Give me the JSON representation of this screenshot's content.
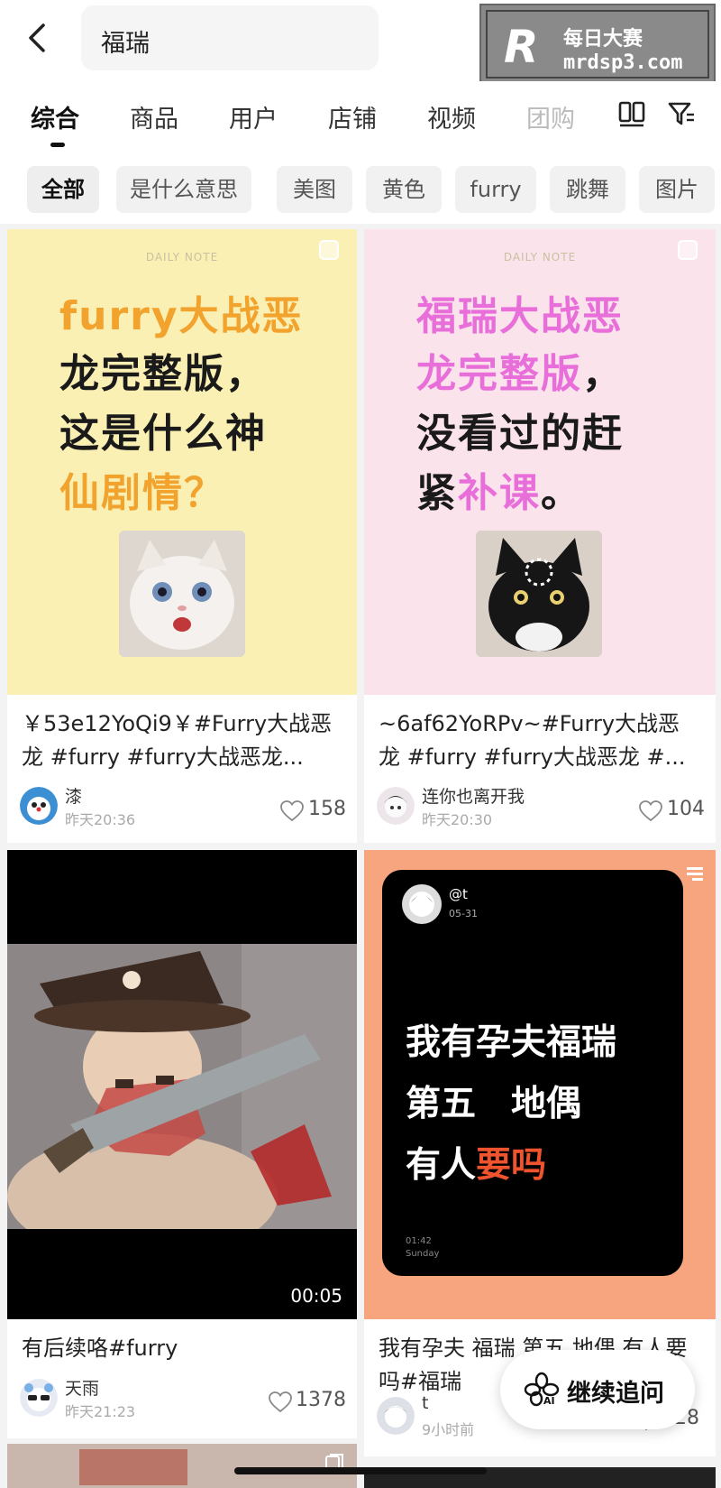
{
  "search": {
    "query": "福瑞"
  },
  "watermark": {
    "logo_letter": "R",
    "line1": "每日大赛",
    "line2": "mrdsp3.com"
  },
  "tabs": [
    {
      "label": "综合",
      "active": true
    },
    {
      "label": "商品"
    },
    {
      "label": "用户"
    },
    {
      "label": "店铺"
    },
    {
      "label": "视频"
    },
    {
      "label": "团购"
    }
  ],
  "chips": [
    {
      "label": "全部",
      "active": true
    },
    {
      "label": "是什么意思"
    },
    {
      "label": "美图"
    },
    {
      "label": "黄色"
    },
    {
      "label": "furry"
    },
    {
      "label": "跳舞"
    },
    {
      "label": "图片"
    }
  ],
  "cards": [
    {
      "poster": {
        "label": "DAILY NOTE",
        "lines": [
          "furry大战恶",
          "龙完整版，",
          "这是什么神",
          "仙剧情？"
        ]
      },
      "caption": "￥53e12YoQi9￥#Furry大战恶龙 #furry #furry大战恶龙...",
      "user": "漆",
      "time": "昨天20:36",
      "likes": "158"
    },
    {
      "poster": {
        "label": "DAILY NOTE",
        "lines": [
          "福瑞大战恶",
          "龙完整版，",
          "没看过的赶",
          "紧补课。"
        ]
      },
      "caption": "~6af62YoRPv~#Furry大战恶龙 #furry #furry大战恶龙 #...",
      "user": "连你也离开我",
      "time": "昨天20:30",
      "likes": "104"
    },
    {
      "duration": "00:05",
      "caption": "有后续咯#furry",
      "user": "天雨",
      "time": "昨天21:23",
      "likes": "1378"
    },
    {
      "phone": {
        "handle": "@t",
        "date": "05-31",
        "lines": [
          "我有孕夫福瑞",
          "第五　地偶",
          "有人要吗"
        ],
        "clock": "01:42",
        "day": "Sunday"
      },
      "caption": "我有孕夫 福瑞 第五 地偶 有人要吗#福瑞",
      "user": "t",
      "time": "9小时前",
      "likes": "428"
    }
  ],
  "followup": {
    "label": "继续追问",
    "badge": "AI"
  },
  "colors": {
    "accent_orange": "#f2a32e",
    "accent_pink": "#e86fd9",
    "text_red": "#f0542f",
    "peach_bg": "#f7a57e"
  }
}
